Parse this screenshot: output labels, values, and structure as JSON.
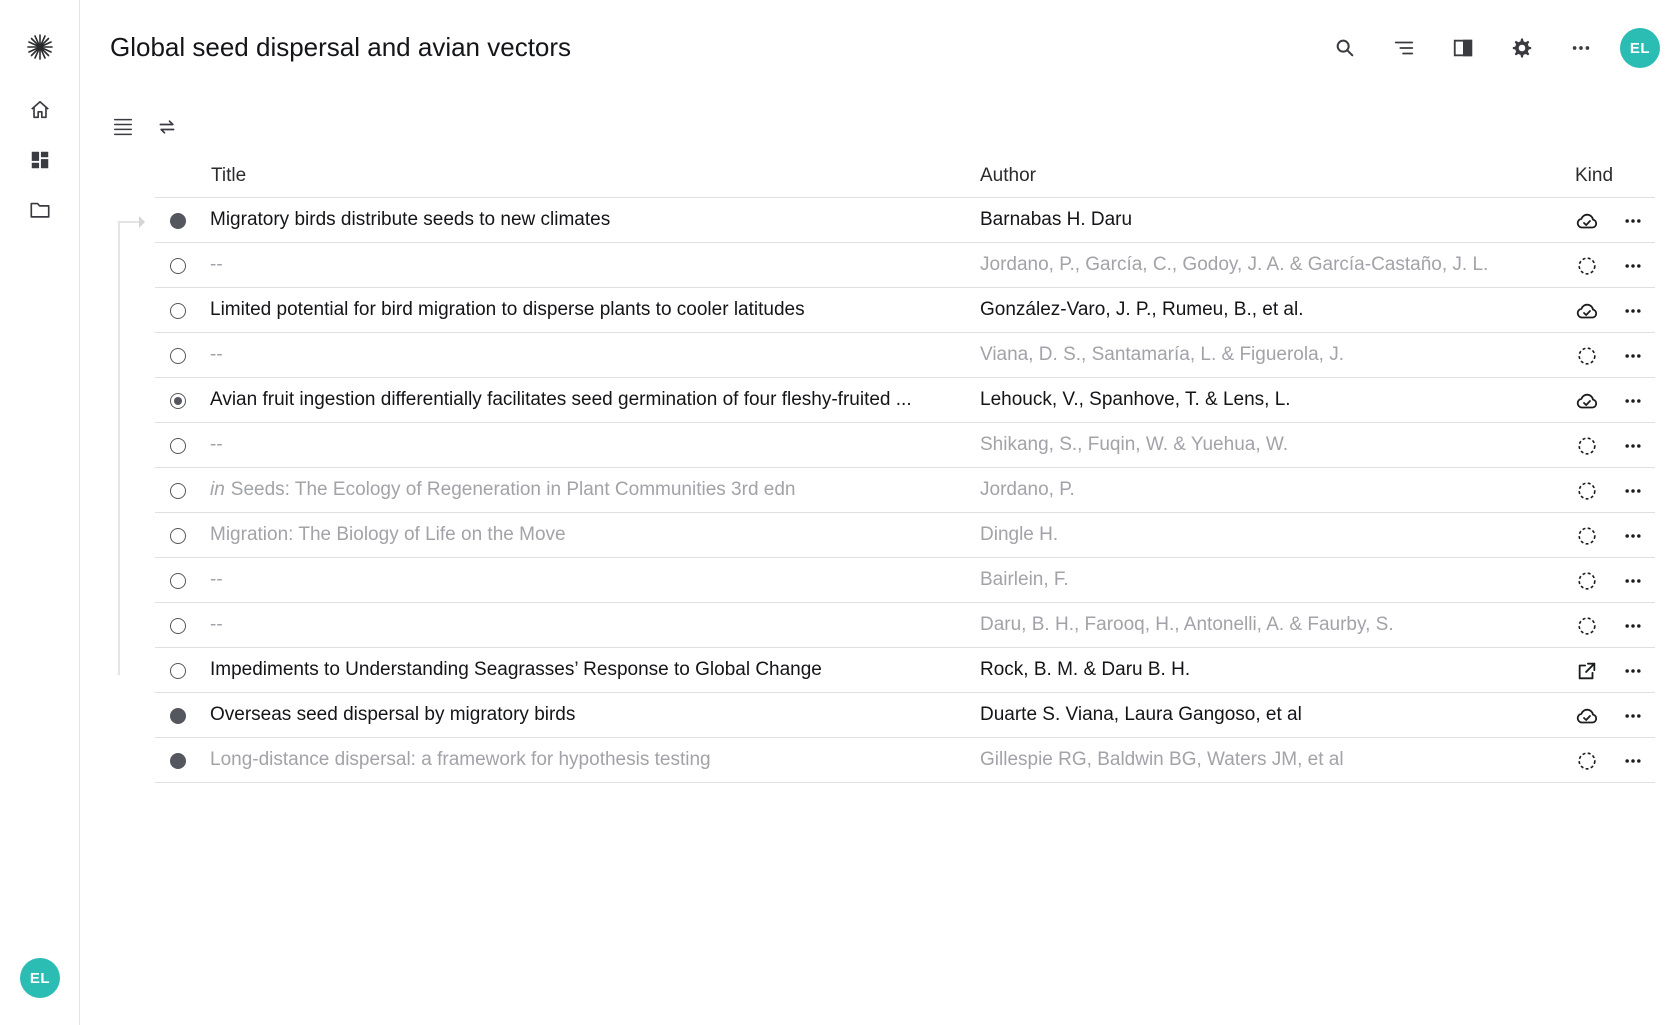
{
  "page_title": "Global seed dispersal and avian vectors",
  "user_initials": "EL",
  "sidebar": {
    "items": [
      {
        "name": "logo-icon"
      },
      {
        "name": "home-icon"
      },
      {
        "name": "dashboard-icon"
      },
      {
        "name": "folder-icon"
      }
    ]
  },
  "toolbar": {
    "icons": [
      "search-icon",
      "outline-icon",
      "sidebar-panel-icon",
      "settings-icon",
      "more-horizontal-icon"
    ]
  },
  "view_tools": [
    "list-view-icon",
    "swap-icon"
  ],
  "table": {
    "headers": {
      "title": "Title",
      "author": "Author",
      "kind": "Kind"
    },
    "rows": [
      {
        "marker": "filled",
        "title": "Migratory birds distribute seeds to new climates",
        "author": "Barnabas H. Daru",
        "kind": "cloud-check",
        "style": "strong"
      },
      {
        "marker": "empty",
        "title": "--",
        "author": "Jordano, P., García, C., Godoy, J. A. & García-Castaño, J. L.",
        "kind": "dashed-circle",
        "style": "muted"
      },
      {
        "marker": "empty",
        "title": "Limited potential for bird migration to disperse plants to cooler latitudes",
        "author": "González-Varo, J. P., Rumeu, B.,  et al.",
        "kind": "cloud-check",
        "style": "strong"
      },
      {
        "marker": "empty",
        "title": "--",
        "author": "Viana, D. S., Santamaría, L. & Figuerola, J.",
        "kind": "dashed-circle",
        "style": "muted"
      },
      {
        "marker": "selected",
        "title": "Avian fruit ingestion differentially facilitates seed germination of four fleshy-fruited ...",
        "author": "Lehouck, V., Spanhove, T. & Lens, L.",
        "kind": "cloud-check",
        "style": "strong"
      },
      {
        "marker": "empty",
        "title": "--",
        "author": "Shikang, S., Fuqin, W. & Yuehua, W.",
        "kind": "dashed-circle",
        "style": "muted"
      },
      {
        "marker": "empty",
        "prefix": "in",
        "title": "Seeds: The Ecology of Regeneration in Plant Communities 3rd edn",
        "author": "Jordano, P.",
        "kind": "dashed-circle",
        "style": "muted"
      },
      {
        "marker": "empty",
        "title": "Migration: The Biology of Life on the Move",
        "author": "Dingle H.",
        "kind": "dashed-circle",
        "style": "muted"
      },
      {
        "marker": "empty",
        "title": "--",
        "author": "Bairlein, F.",
        "kind": "dashed-circle",
        "style": "muted"
      },
      {
        "marker": "empty",
        "title": "--",
        "author": "Daru, B. H., Farooq, H., Antonelli, A. & Faurby, S.",
        "kind": "dashed-circle",
        "style": "muted"
      },
      {
        "marker": "empty",
        "title": "Impediments to Understanding Seagrasses’ Response to Global Change",
        "author": "Rock, B. M. & Daru B. H.",
        "kind": "external-link",
        "style": "strong"
      },
      {
        "marker": "filled",
        "title": "Overseas seed dispersal by migratory birds",
        "author": "Duarte S. Viana, Laura Gangoso, et al",
        "kind": "cloud-check",
        "style": "strong"
      },
      {
        "marker": "filled",
        "title": "Long-distance dispersal: a framework for hypothesis testing",
        "author": "Gillespie RG, Baldwin BG, Waters JM, et al",
        "kind": "dashed-circle",
        "style": "muted"
      }
    ]
  },
  "colors": {
    "accent": "#2bbcb4",
    "text_strong": "#141518",
    "text_muted": "#a2a3a8",
    "border": "#e0e0e3"
  }
}
